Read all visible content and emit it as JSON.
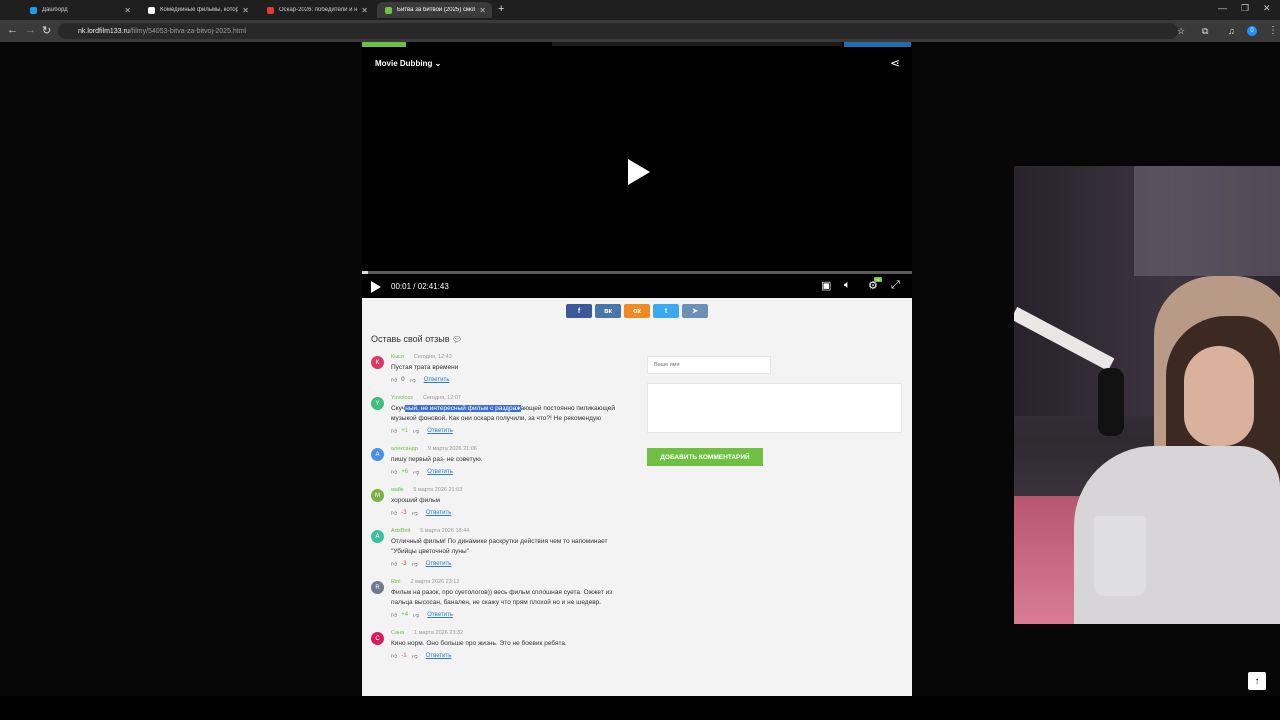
{
  "browser": {
    "tabs": [
      {
        "title": "Дашборд",
        "icon": "x-logo-icon",
        "color": "#1d9bf0",
        "active": false
      },
      {
        "title": "Комедийные фильмы, которые",
        "icon": "sparkle-icon",
        "color": "#ffffff",
        "active": false
      },
      {
        "title": "Оскар-2026: победители и но",
        "icon": "red-square-icon",
        "color": "#e53935",
        "active": false
      },
      {
        "title": "Битва за битвой (2025) смотре",
        "icon": "green-square-icon",
        "color": "#6fc042",
        "active": true
      }
    ],
    "url_domain": "nk.lordfilm133.ru",
    "url_path": "/filmy/54053-bitva-za-bitvoj-2025.html",
    "profile_badge": "0"
  },
  "player": {
    "dubbing_label": "Movie Dubbing",
    "time": "00:01 / 02:41:43",
    "progress": 0.01,
    "hd_badge": "HD"
  },
  "social": [
    {
      "icon": "facebook-icon",
      "glyph": "f",
      "color": "#3b5998"
    },
    {
      "icon": "vk-icon",
      "glyph": "вк",
      "color": "#4a76a8"
    },
    {
      "icon": "odnoklassniki-icon",
      "glyph": "ок",
      "color": "#f08a24"
    },
    {
      "icon": "twitter-icon",
      "glyph": "t",
      "color": "#3aaaf0"
    },
    {
      "icon": "telegram-icon",
      "glyph": "➤",
      "color": "#6b90b7"
    }
  ],
  "comments_section": {
    "title": "Оставь свой отзыв",
    "reply_label": "Ответить",
    "comments": [
      {
        "avatar": "K",
        "avatar_color": "#d83a68",
        "author": "Кыся",
        "date": "Сегодня, 12:43",
        "text_before": "Пустая трата времени",
        "text_selected": "",
        "text_after": "",
        "score": "0",
        "sign": "neutral"
      },
      {
        "avatar": "Y",
        "avatar_color": "#3fbf7f",
        "author": "Yuvoloss",
        "date": "Сегодня, 12:07",
        "text_before": "Скуч",
        "text_selected": "ный, не интересный фильм с раздраж",
        "text_after": "ающей постоянно пиликающей музыкой фоновой. Как они оскара получили, за что?! Не рекомендую",
        "score": "+1",
        "sign": "pos"
      },
      {
        "avatar": "А",
        "avatar_color": "#4a90e2",
        "author": "александр",
        "date": "9 марта 2026 21:06",
        "text_before": "пишу первый раз- не советую.",
        "text_selected": "",
        "text_after": "",
        "score": "+6",
        "sign": "pos"
      },
      {
        "avatar": "M",
        "avatar_color": "#7cb342",
        "author": "майк",
        "date": "5 марта 2026 21:03",
        "text_before": "хороший фильм",
        "text_selected": "",
        "text_after": "",
        "score": "-3",
        "sign": "neg"
      },
      {
        "avatar": "A",
        "avatar_color": "#3fbf9f",
        "author": "ArtsBelt",
        "date": "5 марта 2026 18:44",
        "text_before": "Отличный фильм! По динамике раскрутки действия чем то напоминает \"Убийцы цветочной луны\"",
        "text_selected": "",
        "text_after": "",
        "score": "-3",
        "sign": "neg"
      },
      {
        "avatar": "R",
        "avatar_color": "#6c7a91",
        "author": "Rini",
        "date": "2 марта 2026 23:12",
        "text_before": "Фильм на разок, про суетологов)) весь фильм сплошная суета. Ожжет из пальца высосан, банален, не скажу что прям плохой но и не шедевр.",
        "text_selected": "",
        "text_after": "",
        "score": "+4",
        "sign": "pos"
      },
      {
        "avatar": "C",
        "avatar_color": "#d81b60",
        "author": "Саня",
        "date": "1 марта 2026 23:32",
        "text_before": "Кино норм. Оно больше про жизнь. Это не боевик ребята.",
        "text_selected": "",
        "text_after": "",
        "score": "-1",
        "sign": "neg"
      }
    ]
  },
  "form": {
    "name_placeholder": "Ваше имя",
    "submit_label": "ДОБАВИТЬ КОММЕНТАРИЙ"
  }
}
